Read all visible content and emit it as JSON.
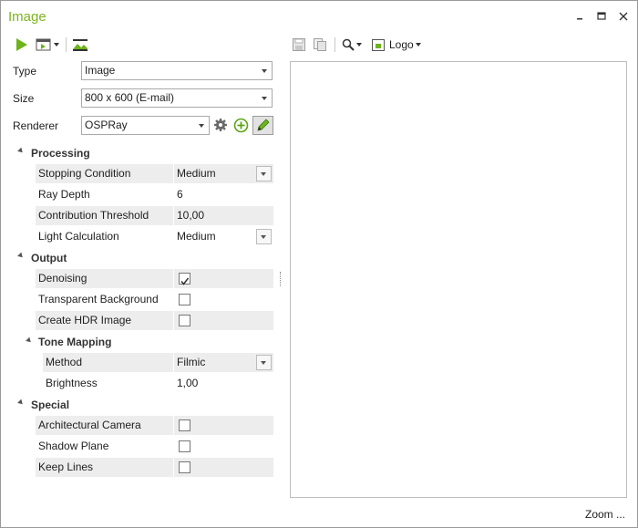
{
  "window": {
    "title": "Image"
  },
  "toolbar_right": {
    "logo_label": "Logo"
  },
  "settings": {
    "type": {
      "label": "Type",
      "value": "Image"
    },
    "size": {
      "label": "Size",
      "value": "800 x 600 (E-mail)"
    },
    "renderer": {
      "label": "Renderer",
      "value": "OSPRay"
    }
  },
  "processing": {
    "header": "Processing",
    "stopping_condition": {
      "label": "Stopping Condition",
      "value": "Medium"
    },
    "ray_depth": {
      "label": "Ray Depth",
      "value": "6"
    },
    "contribution_threshold": {
      "label": "Contribution Threshold",
      "value": "10,00"
    },
    "light_calculation": {
      "label": "Light Calculation",
      "value": "Medium"
    }
  },
  "output": {
    "header": "Output",
    "denoising": {
      "label": "Denoising",
      "checked": true
    },
    "transparent_background": {
      "label": "Transparent Background",
      "checked": false
    },
    "create_hdr_image": {
      "label": "Create HDR Image",
      "checked": false
    },
    "tone_mapping": {
      "header": "Tone Mapping",
      "method": {
        "label": "Method",
        "value": "Filmic"
      },
      "brightness": {
        "label": "Brightness",
        "value": "1,00"
      }
    }
  },
  "special": {
    "header": "Special",
    "architectural_camera": {
      "label": "Architectural Camera",
      "checked": false
    },
    "shadow_plane": {
      "label": "Shadow Plane",
      "checked": false
    },
    "keep_lines": {
      "label": "Keep Lines",
      "checked": false
    }
  },
  "footer": {
    "zoom_label": "Zoom ..."
  },
  "colors": {
    "accent": "#7cb51e",
    "row_shade": "#ededed",
    "border": "#a9a9a9"
  }
}
